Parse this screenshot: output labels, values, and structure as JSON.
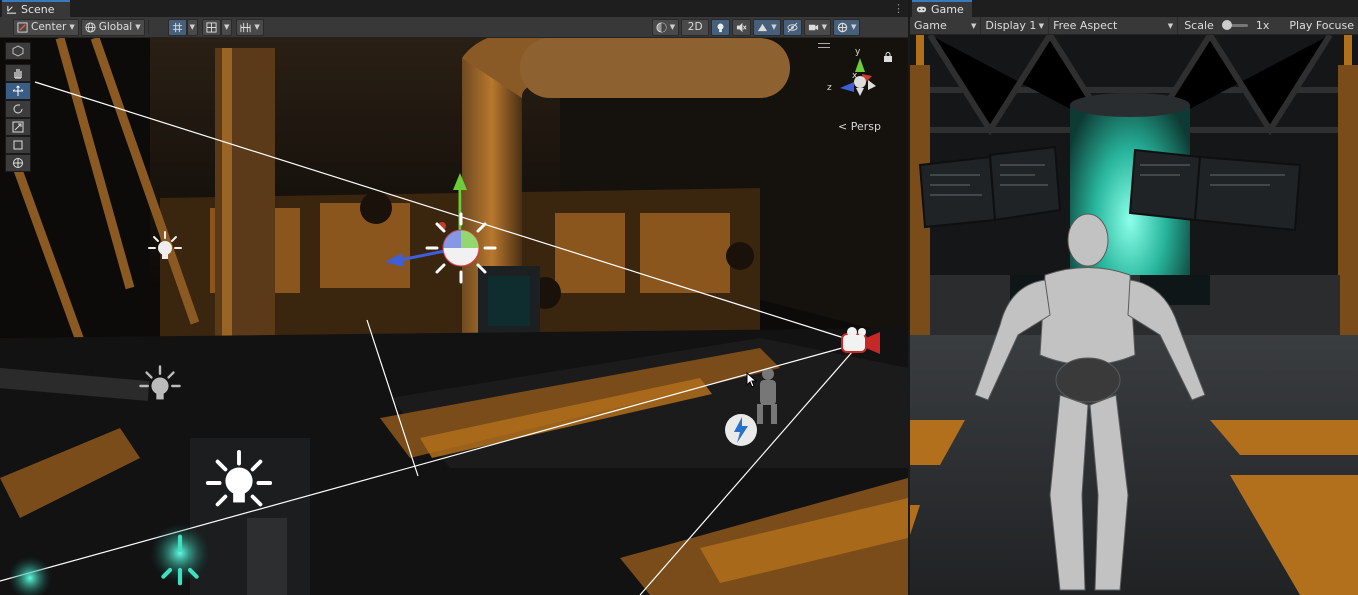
{
  "scene": {
    "tab_label": "Scene",
    "pivot_label": "Center",
    "space_label": "Global",
    "mode_2d_label": "2D",
    "persp_label": "Persp",
    "axis_labels": {
      "x": "x",
      "y": "y",
      "z": "z"
    }
  },
  "game": {
    "tab_label": "Game",
    "view_label": "Game",
    "display_label": "Display 1",
    "aspect_label": "Free Aspect",
    "scale_label": "Scale",
    "scale_value": "1x",
    "play_focused_label": "Play Focuse"
  },
  "icons": {
    "tools": [
      "view-tool-icon",
      "hand-icon",
      "move-icon",
      "rotate-icon",
      "scale-icon",
      "rect-icon",
      "transform-icon"
    ],
    "gizmos": [
      "light-icon",
      "camera-icon",
      "lightning-icon",
      "lock-icon",
      "kebab-menu-icon"
    ]
  },
  "colors": {
    "accent": "#3a79bb",
    "axis_x": "#c83c2c",
    "axis_y": "#6ccc3a",
    "axis_z": "#3e5fd8",
    "wood": "#b26f1c",
    "teal_glow": "#3fe0c2"
  }
}
